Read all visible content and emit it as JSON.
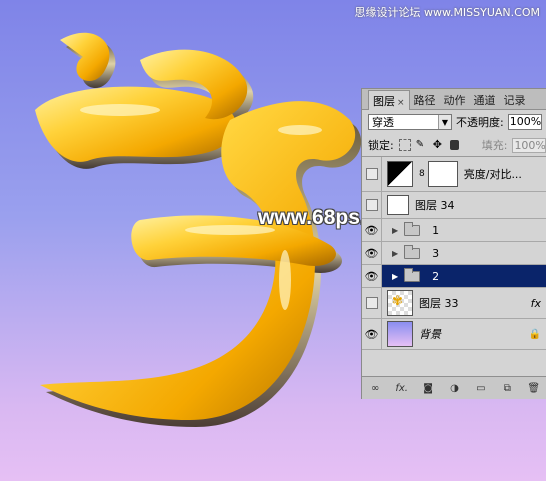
{
  "watermark_top": "思缘设计论坛 www.MISSYUAN.COM",
  "watermark_mid": "www.68ps.com",
  "tabs": [
    {
      "label": "图层",
      "active": true,
      "close": "×"
    },
    {
      "label": "路径"
    },
    {
      "label": "动作"
    },
    {
      "label": "通道"
    },
    {
      "label": "记录"
    }
  ],
  "blend_mode": "穿透",
  "opacity_label": "不透明度:",
  "opacity_value": "100%",
  "lock_label": "锁定:",
  "fill_label": "填充:",
  "fill_value": "100%",
  "layers": [
    {
      "name": "亮度/对比...",
      "type": "adjustment",
      "visible": false
    },
    {
      "name": "图层 34",
      "type": "image",
      "visible": false
    },
    {
      "name": "1",
      "type": "group",
      "visible": true
    },
    {
      "name": "3",
      "type": "group",
      "visible": true
    },
    {
      "name": "2",
      "type": "group",
      "visible": true,
      "selected": true
    },
    {
      "name": "图层 33",
      "type": "image",
      "visible": false,
      "fx": "fx"
    },
    {
      "name": "背景",
      "type": "background",
      "visible": true,
      "locked": true
    }
  ],
  "colors": {
    "canvas_top": "#7f84e8",
    "canvas_bottom": "#e6c0f4",
    "gold_light": "#ffd84a",
    "gold_dark": "#c77a00",
    "selection": "#0a246a"
  }
}
